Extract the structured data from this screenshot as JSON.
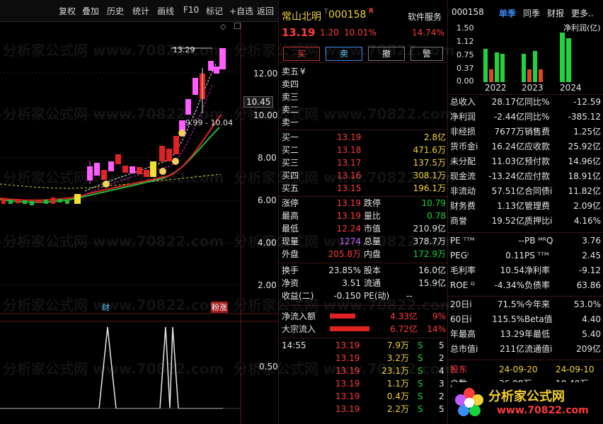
{
  "toolbar": {
    "items": [
      "复权",
      "叠加",
      "历史",
      "统计",
      "画线",
      "F10",
      "标记",
      "+自选",
      "返回"
    ]
  },
  "chart": {
    "price_ticks": [
      "12.00",
      "10.00",
      "8.00",
      "6.00",
      "4.00",
      "2.00"
    ],
    "current_price_tag": "10.45",
    "high_label": "13.29",
    "range_label": "9.99 - 10.04",
    "marker_cai": "财",
    "marker_ljz": "粉涨",
    "lower_tick": "0.50",
    "diamond": "◇",
    "square": "☐"
  },
  "quote": {
    "name": "常山北明",
    "tag": "T",
    "code": "000158",
    "r": "R",
    "sector": "软件服务",
    "price": "13.19",
    "change": "1.20",
    "change_pct": "10.01%",
    "sector_pct": "14.74%",
    "buttons": [
      "买",
      "卖",
      "撤",
      "警"
    ]
  },
  "orderbook": {
    "sells": [
      {
        "label": "卖五",
        "price": "¥",
        "vol": ""
      },
      {
        "label": "卖四",
        "price": "",
        "vol": ""
      },
      {
        "label": "卖三",
        "price": "",
        "vol": ""
      },
      {
        "label": "卖二",
        "price": "",
        "vol": ""
      },
      {
        "label": "卖一",
        "price": "",
        "vol": ""
      }
    ],
    "buys": [
      {
        "label": "买一",
        "price": "13.19",
        "vol": "2.8亿"
      },
      {
        "label": "买二",
        "price": "13.18",
        "vol": "471.6万"
      },
      {
        "label": "买三",
        "price": "13.17",
        "vol": "137.5万"
      },
      {
        "label": "买四",
        "price": "13.16",
        "vol": "308.1万"
      },
      {
        "label": "买五",
        "price": "13.15",
        "vol": "196.1万"
      }
    ]
  },
  "stats": [
    {
      "l1": "涨停",
      "v1": "13.19",
      "c1": "red",
      "l2": "跌停",
      "v2": "10.79",
      "c2": "green"
    },
    {
      "l1": "最高",
      "v1": "13.19",
      "c1": "red",
      "l2": "量比",
      "v2": "0.78",
      "c2": "green"
    },
    {
      "l1": "最低",
      "v1": "12.24",
      "c1": "red",
      "l2": "市值",
      "v2": "210.9亿",
      "c2": "white"
    },
    {
      "l1": "现量",
      "v1": "1274",
      "c1": "mag",
      "l2": "总量",
      "v2": "378.7万",
      "c2": "white"
    },
    {
      "l1": "外盘",
      "v1": "205.8万",
      "c1": "red",
      "l2": "内盘",
      "v2": "172.9万",
      "c2": "green"
    },
    {
      "l1": "换手",
      "v1": "23.85%",
      "c1": "white",
      "l2": "股本",
      "v2": "16.0亿",
      "c2": "white"
    },
    {
      "l1": "净资",
      "v1": "3.51",
      "c1": "white",
      "l2": "流通",
      "v2": "15.9亿",
      "c2": "white"
    },
    {
      "l1": "收益(二)",
      "v1": "-0.150",
      "c1": "white",
      "l2": "PE(动)",
      "v2": "--",
      "c2": "white"
    }
  ],
  "flows": [
    {
      "label": "净流入额",
      "val": "4.33亿",
      "pct": "9%"
    },
    {
      "label": "大宗流入",
      "val": "6.72亿",
      "pct": "14%"
    }
  ],
  "ticks": {
    "time": "14:55",
    "rows": [
      {
        "price": "13.19",
        "vol": "7.9万",
        "side": "S",
        "n": "5"
      },
      {
        "price": "13.19",
        "vol": "3.2万",
        "side": "S",
        "n": "2"
      },
      {
        "price": "13.19",
        "vol": "23.1万",
        "side": "S",
        "n": "4"
      },
      {
        "price": "13.19",
        "vol": "1.1万",
        "side": "S",
        "n": "3"
      },
      {
        "price": "13.19",
        "vol": "0.4万",
        "side": "S",
        "n": "2"
      },
      {
        "price": "13.19",
        "vol": "2.2万",
        "side": "S",
        "n": "5"
      }
    ]
  },
  "fin": {
    "code": "000158",
    "tabs": [
      "单季",
      "同季",
      "财报",
      "更多.."
    ],
    "chart_title": "净利润(亿)",
    "y_ticks": [
      "1.50",
      "1.12",
      "0.75",
      "0.37",
      "0.00"
    ],
    "years": [
      "2022",
      "2023",
      "2024"
    ],
    "rows": [
      {
        "l1": "总收入",
        "v1": "28.17亿",
        "l2": "同比%",
        "v2": "-12.59"
      },
      {
        "l1": "净利润",
        "v1": "-2.44亿",
        "l2": "同比%",
        "v2": "-385.12"
      },
      {
        "l1": "非经损",
        "v1": "7677万",
        "l2": "销售费",
        "v2": "1.25亿"
      },
      {
        "l1": "货币金i",
        "v1": "16.24亿",
        "l2": "应收款",
        "v2": "25.92亿"
      },
      {
        "l1": "未分配",
        "v1": "11.03亿",
        "l2": "预付款",
        "v2": "14.96亿"
      },
      {
        "l1": "现金流",
        "v1": "-13.24亿",
        "l2": "应付款",
        "v2": "18.91亿"
      },
      {
        "l1": "非流动",
        "v1": "57.51亿",
        "l2": "合同债i",
        "v2": "11.82亿"
      },
      {
        "l1": "财务费",
        "v1": "1.13亿",
        "l2": "管理费",
        "v2": "2.09亿"
      },
      {
        "l1": "商誉",
        "v1": "19.52亿",
        "l2": "质押比i",
        "v2": "4.16%"
      }
    ],
    "val_rows": [
      {
        "l1": "PE ᵀᵀᴹ",
        "v1": "--",
        "l2": "PB ᴹᴿQ",
        "v2": "3.76"
      },
      {
        "l1": "PEGⁱ",
        "v1": "0.11",
        "l2": "PS ᵀᵀᴹ",
        "v2": "2.45"
      },
      {
        "l1": "毛利率",
        "v1": "10.54",
        "l2": "净利率",
        "v2": "-9.12"
      },
      {
        "l1": "ROE ᴰ",
        "v1": "-4.34%",
        "l2": "负债率",
        "v2": "63.86"
      }
    ],
    "perf_rows": [
      {
        "l1": "20日i",
        "v1": "71.5%",
        "l2": "今年来",
        "v2": "53.0%"
      },
      {
        "l1": "60日i",
        "v1": "115.5%",
        "l2": "Beta值",
        "v2": "4.40"
      },
      {
        "l1": "年最高",
        "v1": "13.29",
        "l2": "年最低",
        "v2": "5.40"
      },
      {
        "l1": "总市值i",
        "v1": "211亿",
        "l2": "流通值i",
        "v2": "209亿"
      }
    ],
    "holder_label": "股东",
    "holder_d1": "24-09-20",
    "holder_d2": "24-09-10",
    "partial_label": "户数",
    "partial_v1": "36.08万",
    "partial_v2": "10.40万"
  },
  "brand": {
    "name": "分析家公式网",
    "url": "www.70822.com"
  },
  "watermark": "分析家公式网 www.70822.com"
}
